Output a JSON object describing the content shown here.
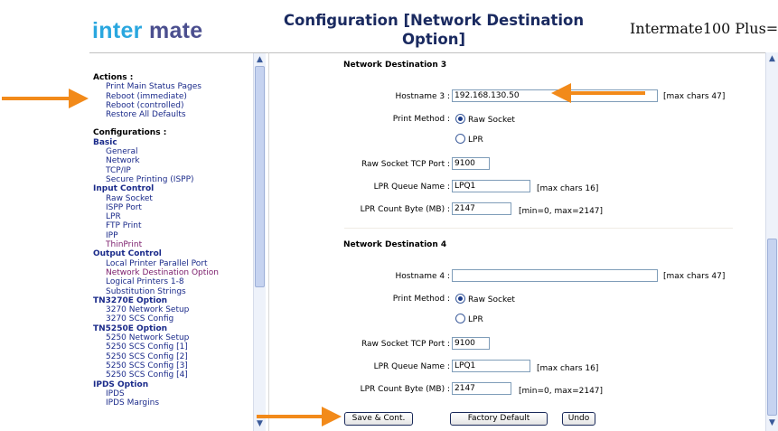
{
  "header": {
    "logo_part1": "inter",
    "logo_part2": "mate",
    "title": "Configuration [Network Destination Option]",
    "model": "Intermate100 Plus="
  },
  "sidebar": {
    "actions_heading": "Actions :",
    "actions": [
      "Print Main Status Pages",
      "Reboot (immediate)",
      "Reboot (controlled)",
      "Restore All Defaults"
    ],
    "config_heading": "Configurations :",
    "groups": [
      {
        "title": "Basic",
        "items": [
          "General",
          "Network",
          "TCP/IP",
          "Secure Printing (ISPP)"
        ]
      },
      {
        "title": "Input Control",
        "items": [
          "Raw Socket",
          "ISPP Port",
          "LPR",
          "FTP Print",
          "IPP",
          "ThinPrint"
        ]
      },
      {
        "title": "Output Control",
        "items": [
          "Local Printer Parallel Port",
          "Network Destination Option",
          "Logical Printers 1-8",
          "Substitution Strings"
        ]
      },
      {
        "title": "TN3270E Option",
        "items": [
          "3270 Network Setup",
          "3270 SCS Config"
        ]
      },
      {
        "title": "TN5250E Option",
        "items": [
          "5250 Network Setup",
          "5250 SCS Config [1]",
          "5250 SCS Config [2]",
          "5250 SCS Config [3]",
          "5250 SCS Config [4]"
        ]
      },
      {
        "title": "IPDS Option",
        "items": [
          "IPDS",
          "IPDS Margins"
        ]
      }
    ],
    "scroll_up": "▲",
    "scroll_down": "▼"
  },
  "dest3": {
    "title": "Network Destination 3",
    "hostname_label": "Hostname 3 :",
    "hostname_value": "192.168.130.50",
    "hostname_hint": "[max chars 47]",
    "print_method_label": "Print Method :",
    "raw_socket_label": "Raw Socket",
    "lpr_label": "LPR",
    "selected_method": "Raw Socket",
    "tcp_port_label": "Raw Socket TCP Port :",
    "tcp_port_value": "9100",
    "queue_label": "LPR Queue Name :",
    "queue_value": "LPQ1",
    "queue_hint": "[max chars 16]",
    "count_label": "LPR Count Byte (MB) :",
    "count_value": "2147",
    "count_hint": "[min=0, max=2147]"
  },
  "dest4": {
    "title": "Network Destination 4",
    "hostname_label": "Hostname 4 :",
    "hostname_value": "",
    "hostname_hint": "[max chars 47]",
    "print_method_label": "Print Method :",
    "raw_socket_label": "Raw Socket",
    "lpr_label": "LPR",
    "selected_method": "Raw Socket",
    "tcp_port_label": "Raw Socket TCP Port :",
    "tcp_port_value": "9100",
    "queue_label": "LPR Queue Name :",
    "queue_value": "LPQ1",
    "queue_hint": "[max chars 16]",
    "count_label": "LPR Count Byte (MB) :",
    "count_value": "2147",
    "count_hint": "[min=0, max=2147]"
  },
  "buttons": {
    "save": "Save & Cont.",
    "factory": "Factory Default",
    "undo": "Undo"
  },
  "colors": {
    "arrow": "#f28a1a",
    "link": "#1a2a8a",
    "visited": "#7a1a6a"
  }
}
